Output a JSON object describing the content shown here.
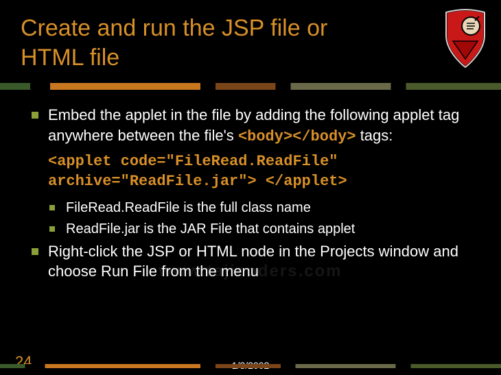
{
  "title": "Create and run the JSP file or HTML file",
  "bullets": {
    "b1_pre": "Embed the applet in the file by adding the following applet tag anywhere between the file's ",
    "b1_code": "<body></body>",
    "b1_post": " tags:",
    "codeblock_l1": "<applet code=\"FileRead.ReadFile\"",
    "codeblock_l2": "archive=\"ReadFile.jar\"> </applet>",
    "sub1": "FileRead.ReadFile is the full class name",
    "sub2": "ReadFile.jar is the JAR File that contains applet",
    "b2": "Right-click the JSP or HTML node in the Projects window and choose Run File from the menu"
  },
  "footer": {
    "slide_number": "24",
    "date": "1/3/2002"
  },
  "watermark": "www.tajicoders.com"
}
